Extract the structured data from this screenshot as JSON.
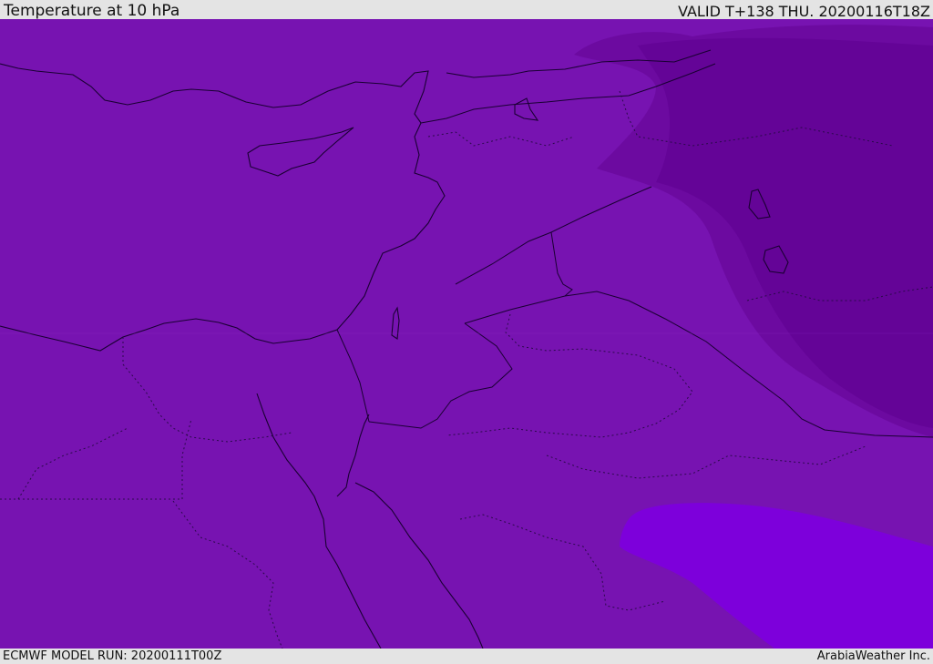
{
  "header": {
    "title": "Temperature at 10 hPa",
    "valid": "VALID T+138 THU. 20200116T18Z"
  },
  "footer": {
    "model_run": "ECMWF MODEL RUN: 20200111T00Z",
    "credit": "ArabiaWeather Inc."
  },
  "colors": {
    "field_base": "#7713b1",
    "field_dark": "#6c0aa0",
    "field_darker": "#640497",
    "field_bright": "#7d00db",
    "lines": "#1a0033"
  }
}
